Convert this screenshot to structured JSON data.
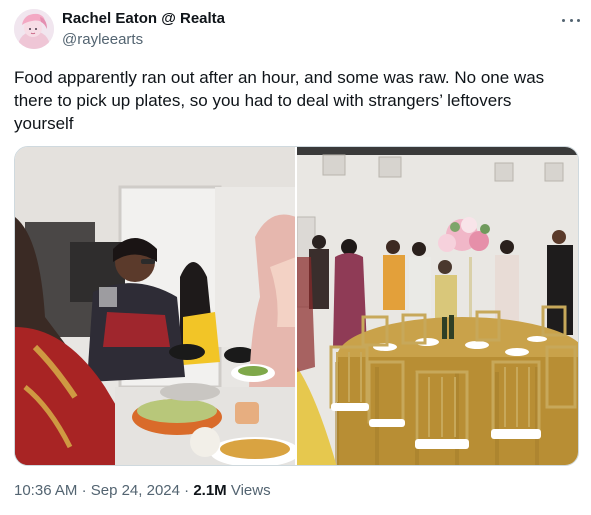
{
  "author": {
    "display_name": "Rachel Eaton @ Realta",
    "handle": "@rayleearts",
    "avatar_icon": "avatar-illustration-icon"
  },
  "tweet": {
    "text": "Food apparently ran out after an hour, and some was raw. No one was there to pick up plates, so you had to deal with strangers’ leftovers yourself"
  },
  "media": {
    "photos": [
      {
        "description_icon": "buffet-photo"
      },
      {
        "description_icon": "banquet-hall-photo"
      }
    ]
  },
  "meta": {
    "time": "10:36 AM",
    "separator": "·",
    "date": "Sep 24, 2024",
    "views_count": "2.1M",
    "views_label": "Views"
  },
  "colors": {
    "text": "#0f1419",
    "secondary": "#536471",
    "border": "#cfd9de"
  }
}
